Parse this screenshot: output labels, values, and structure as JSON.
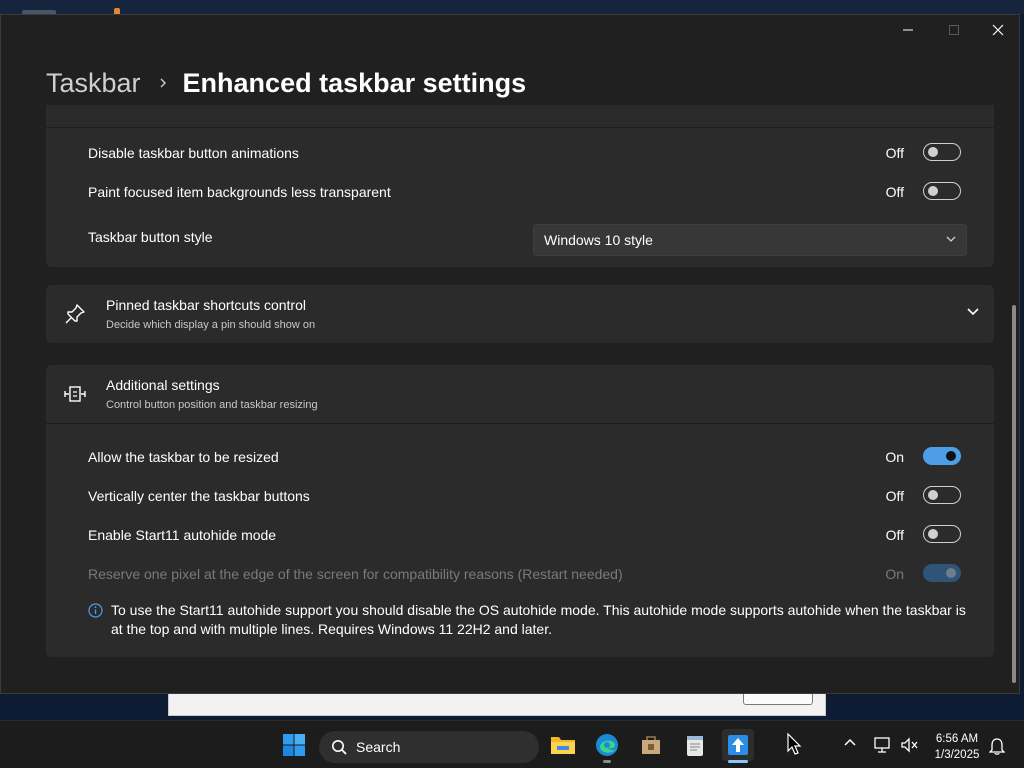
{
  "window": {
    "breadcrumb": {
      "parent": "Taskbar",
      "current": "Enhanced taskbar settings"
    }
  },
  "section_top": {
    "rows": [
      {
        "label": "Disable taskbar button animations",
        "state": "Off",
        "on": false
      },
      {
        "label": "Paint focused item backgrounds less transparent",
        "state": "Off",
        "on": false
      }
    ],
    "style_label": "Taskbar button style",
    "style_value": "Windows 10 style"
  },
  "pinned": {
    "title": "Pinned taskbar shortcuts control",
    "subtitle": "Decide which display a pin should show on",
    "icon": "pin-icon"
  },
  "additional": {
    "title": "Additional settings",
    "subtitle": "Control button position and taskbar resizing",
    "icon": "resize-icon",
    "rows": [
      {
        "label": "Allow the taskbar to be resized",
        "state": "On",
        "on": true,
        "enabled": true
      },
      {
        "label": "Vertically center the taskbar buttons",
        "state": "Off",
        "on": false,
        "enabled": true
      },
      {
        "label": "Enable Start11 autohide mode",
        "state": "Off",
        "on": false,
        "enabled": true
      },
      {
        "label": "Reserve one pixel at the edge of the screen for compatibility reasons (Restart needed)",
        "state": "On",
        "on": true,
        "enabled": false
      }
    ],
    "info": "To use the Start11 autohide support you should disable the OS autohide mode.  This autohide mode supports autohide when the taskbar is at the top and with multiple lines.  Requires Windows 11 22H2 and later."
  },
  "taskbar": {
    "search_placeholder": "Search",
    "apps": [
      "windows-start-icon",
      "file-explorer-icon",
      "edge-icon",
      "store-icon",
      "notepad-icon",
      "start11-icon"
    ],
    "clock_time": "6:56 AM",
    "clock_date": "1/3/2025"
  },
  "colors": {
    "accent": "#4d9ee6",
    "window_bg": "#202020",
    "card_bg": "#2b2b2b"
  }
}
